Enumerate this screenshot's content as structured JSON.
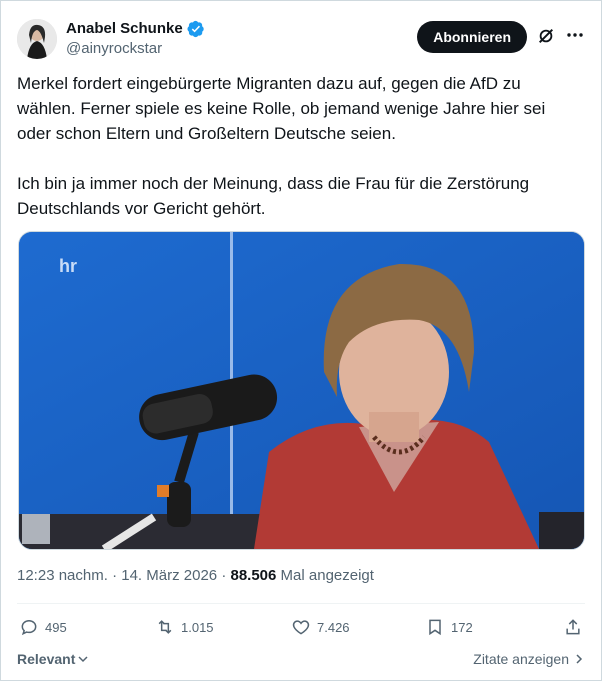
{
  "author": {
    "display_name": "Anabel Schunke",
    "handle": "@ainyrockstar"
  },
  "header": {
    "subscribe_label": "Abonnieren"
  },
  "tweet": {
    "paragraphs": [
      "Merkel fordert eingebürgerte Migranten dazu auf, gegen die AfD zu wählen. Ferner spiele es keine Rolle, ob jemand wenige Jahre hier sei oder schon Eltern und Großeltern Deutsche seien.",
      "Ich bin ja immer noch der Meinung, dass die Frau für die Zerstörung Deutschlands vor Gericht gehört."
    ]
  },
  "media": {
    "channel_logo": "hr",
    "accent": "#1f6fd3"
  },
  "meta": {
    "time": "12:23 nachm.",
    "separator": " · ",
    "date": "14. März 2026",
    "views": "88.506",
    "views_suffix": "Mal angezeigt"
  },
  "actions": {
    "replies": "495",
    "reposts": "1.015",
    "likes": "7.426",
    "bookmarks": "172"
  },
  "footer": {
    "sort_label": "Relevant",
    "quotes_label": "Zitate anzeigen"
  },
  "colors": {
    "verified": "#1d9bf0",
    "text": "#0f1419",
    "secondary": "#536471"
  }
}
